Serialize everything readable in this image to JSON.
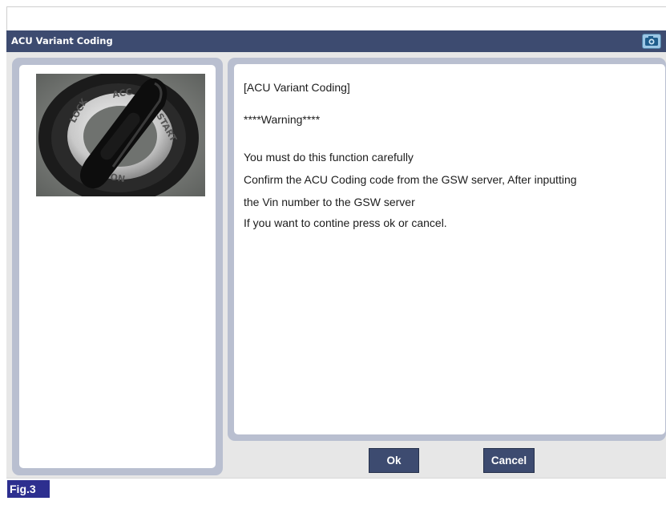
{
  "window": {
    "title": "ACU Variant Coding",
    "title_bar_color": "#3d4b70",
    "camera_icon": "camera-icon"
  },
  "photo": {
    "description_icon": "ignition-key-switch-photo",
    "switch_labels": [
      "LOCK",
      "ACC",
      "START",
      "ON"
    ]
  },
  "message": {
    "lines": [
      "[ACU Variant Coding]",
      "****Warning****",
      "You must do this function carefully",
      "Confirm the ACU Coding code from the GSW server, After inputting",
      "the Vin number to the GSW server",
      "If you want to contine press ok or cancel."
    ]
  },
  "buttons": {
    "ok_label": "Ok",
    "cancel_label": "Cancel"
  },
  "figure": {
    "label": "Fig.3",
    "label_color": "#2d2f8f"
  }
}
